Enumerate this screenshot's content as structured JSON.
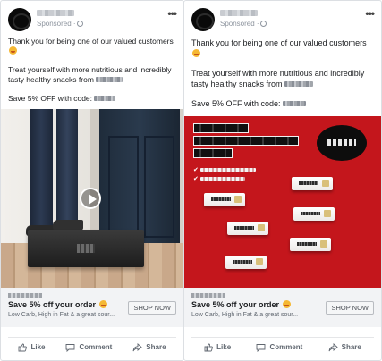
{
  "ads": [
    {
      "sponsored": "Sponsored",
      "text_line_1": "Thank you for being one of our valued customers",
      "text_line_2": "Treat yourself with more nutritious and incredibly tasty healthy snacks from",
      "text_line_3": "Save 5% OFF with code:",
      "link_title": "Save 5% off your order",
      "link_description": "Low Carb, High in Fat & a great sour...",
      "cta": "SHOP NOW",
      "like": "Like",
      "comment": "Comment",
      "share": "Share"
    },
    {
      "sponsored": "Sponsored",
      "text_line_1": "Thank you for being one of our valued customers",
      "text_line_2": "Treat yourself with more nutritious and incredibly tasty healthy snacks from",
      "text_line_3": "Save 5% OFF with code:",
      "link_title": "Save 5% off your order",
      "link_description": "Low Carb, High in Fat & a great sour...",
      "cta": "SHOP NOW",
      "like": "Like",
      "comment": "Comment",
      "share": "Share"
    }
  ],
  "colors": {
    "ad_background_red": "#c4161c",
    "link_bar_background": "#f2f3f5",
    "muted_text": "#606770"
  },
  "icons": [
    "globe-icon",
    "more-icon",
    "play-icon",
    "like-icon",
    "comment-icon",
    "share-icon"
  ]
}
